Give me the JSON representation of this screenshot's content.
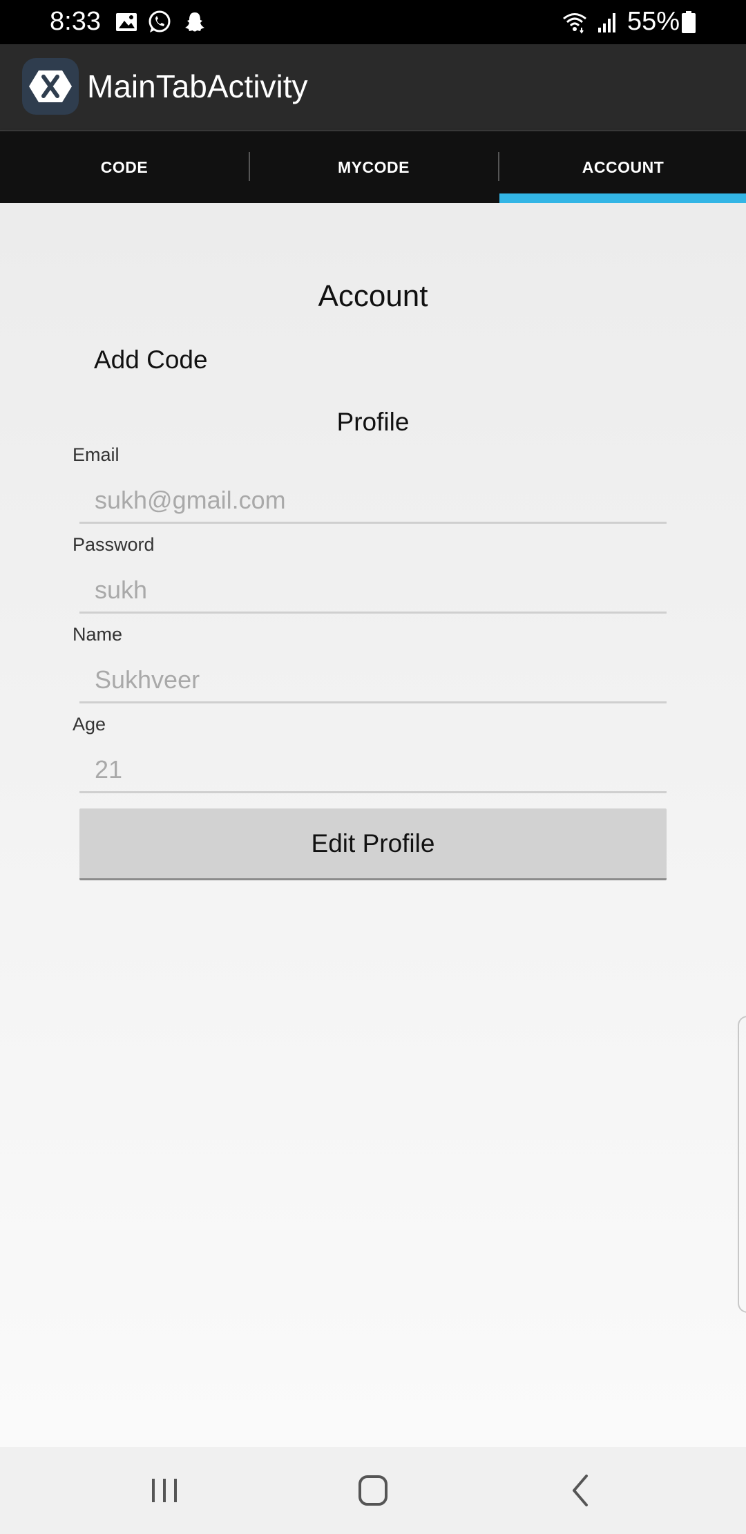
{
  "status_bar": {
    "time": "8:33",
    "battery": "55%",
    "icons": [
      "image-icon",
      "whatsapp-icon",
      "snapchat-icon",
      "wifi-icon",
      "signal-icon",
      "battery-icon"
    ]
  },
  "app_bar": {
    "title": "MainTabActivity",
    "logo_icon": "xamarin-logo-icon"
  },
  "tabs": [
    {
      "label": "CODE",
      "selected": false
    },
    {
      "label": "MYCODE",
      "selected": false
    },
    {
      "label": "ACCOUNT",
      "selected": true
    }
  ],
  "colors": {
    "accent": "#33b5e5",
    "app_bar": "#2a2a2a",
    "tab_bar": "#111111"
  },
  "account": {
    "title": "Account",
    "add_code": "Add Code",
    "profile_title": "Profile",
    "fields": [
      {
        "label": "Email",
        "value": "sukh@gmail.com"
      },
      {
        "label": "Password",
        "value": "sukh"
      },
      {
        "label": "Name",
        "value": "Sukhveer"
      },
      {
        "label": "Age",
        "value": "21"
      }
    ],
    "edit_button": "Edit Profile"
  },
  "nav_bar": {
    "buttons": [
      "recent-apps-icon",
      "home-icon",
      "back-icon"
    ]
  }
}
